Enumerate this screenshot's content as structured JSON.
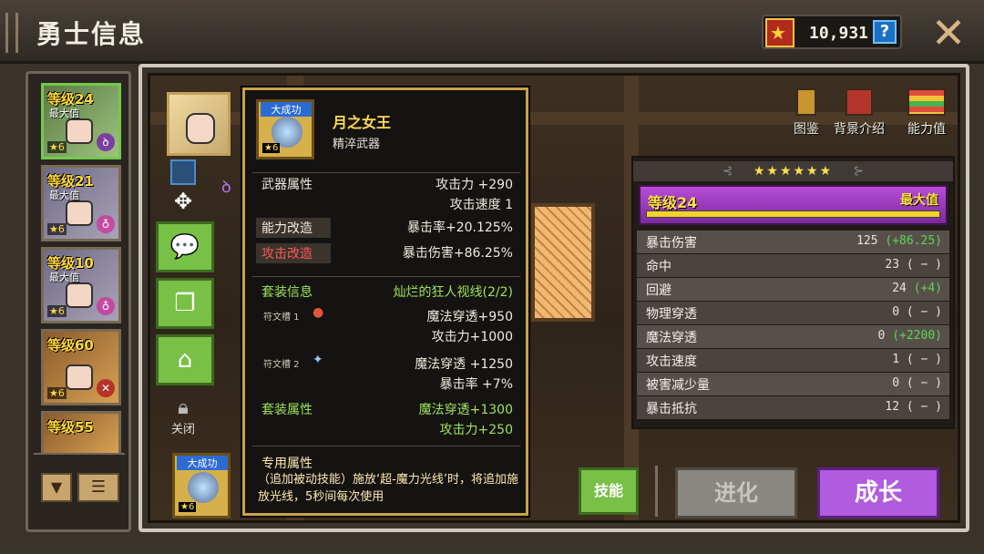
{
  "header": {
    "title": "勇士信息",
    "currency_amount": "10,931",
    "help_icon": "?"
  },
  "hero_list": [
    {
      "level": "等级24",
      "max": "最大值",
      "stars": "★6",
      "selected": true
    },
    {
      "level": "等级21",
      "max": "最大值",
      "stars": "★6",
      "selected": false
    },
    {
      "level": "等级10",
      "max": "最大值",
      "stars": "★6",
      "selected": false
    },
    {
      "level": "等级60",
      "max": "",
      "stars": "★6",
      "selected": false
    },
    {
      "level": "等级55",
      "max": "",
      "stars": "",
      "selected": false
    }
  ],
  "left_side": {
    "lock_label": "关闭"
  },
  "top_tabs": {
    "codex": "图鉴",
    "background": "背景介绍",
    "stats": "能力值"
  },
  "stats_panel": {
    "stars": "★★★★★★",
    "level": "等级24",
    "max": "最大值",
    "rows": [
      {
        "label": "暴击伤害",
        "value": "125",
        "bonus": "(+86.25)"
      },
      {
        "label": "命中",
        "value": "23",
        "bonus": "( − )"
      },
      {
        "label": "回避",
        "value": "24",
        "bonus": "(+4)"
      },
      {
        "label": "物理穿透",
        "value": "0",
        "bonus": "( − )"
      },
      {
        "label": "魔法穿透",
        "value": "0",
        "bonus": "(+2200)"
      },
      {
        "label": "攻击速度",
        "value": "1",
        "bonus": "( − )"
      },
      {
        "label": "被害减少量",
        "value": "0",
        "bonus": "( − )"
      },
      {
        "label": "暴击抵抗",
        "value": "12",
        "bonus": "( − )"
      }
    ]
  },
  "tooltip": {
    "badge": "大成功",
    "stars": "★6",
    "name": "月之女王",
    "subtitle": "精淬武器",
    "weapon_attr_label": "武器属性",
    "weapon_attr_1": "攻击力 +290",
    "weapon_attr_2": "攻击速度 1",
    "ability_mod_label": "能力改造",
    "ability_mod_value": "暴击率+20.125%",
    "attack_mod_label": "攻击改造",
    "attack_mod_value": "暴击伤害+86.25%",
    "set_info_label": "套装信息",
    "set_info_value": "灿烂的狂人视线(2/2)",
    "rune1_label": "符文槽 1",
    "rune1_v1": "魔法穿透+950",
    "rune1_v2": "攻击力+1000",
    "rune2_label": "符文槽 2",
    "rune2_v1": "魔法穿透 +1250",
    "rune2_v2": "暴击率 +7%",
    "set_attr_label": "套装属性",
    "set_attr_v1": "魔法穿透+1300",
    "set_attr_v2": "攻击力+250",
    "exclusive_label": "专用属性",
    "exclusive_desc": "（追加被动技能）施放‘超-魔力光线’时，将追加施放光线，5秒间每次使用"
  },
  "bottom": {
    "weapon_badge": "大成功",
    "weapon_stars": "★6",
    "skill": "技能",
    "evolve": "进化",
    "grow": "成长"
  }
}
